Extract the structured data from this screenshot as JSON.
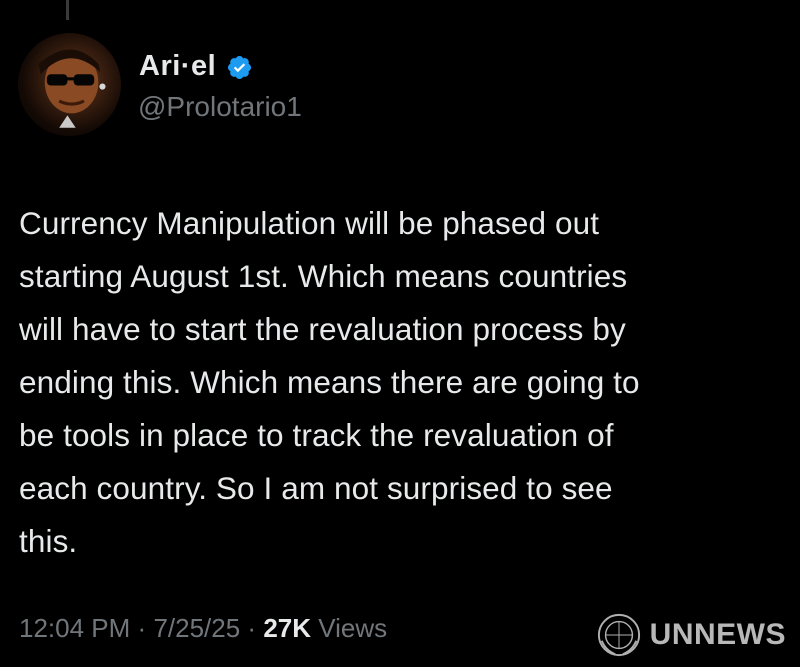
{
  "user": {
    "display_name": "Ari·el",
    "handle": "@Prolotario1",
    "verified": true
  },
  "tweet": {
    "text": "Currency Manipulation will be phased out\nstarting August 1st. Which means countries\nwill have to start the revaluation process by\nending this. Which means there are going to\nbe tools in place to track the revaluation of\neach country. So I am not surprised to see\nthis."
  },
  "meta": {
    "time": "12:04 PM",
    "separator": "·",
    "date": "7/25/25",
    "views_count": "27K",
    "views_label": "Views"
  },
  "watermark": {
    "text": "UNNEWS",
    "emblem_text": "UNNEWS"
  },
  "colors": {
    "background": "#000000",
    "text_primary": "#e7e9ea",
    "text_secondary": "#71767b",
    "verified_blue": "#1d9bf0"
  }
}
